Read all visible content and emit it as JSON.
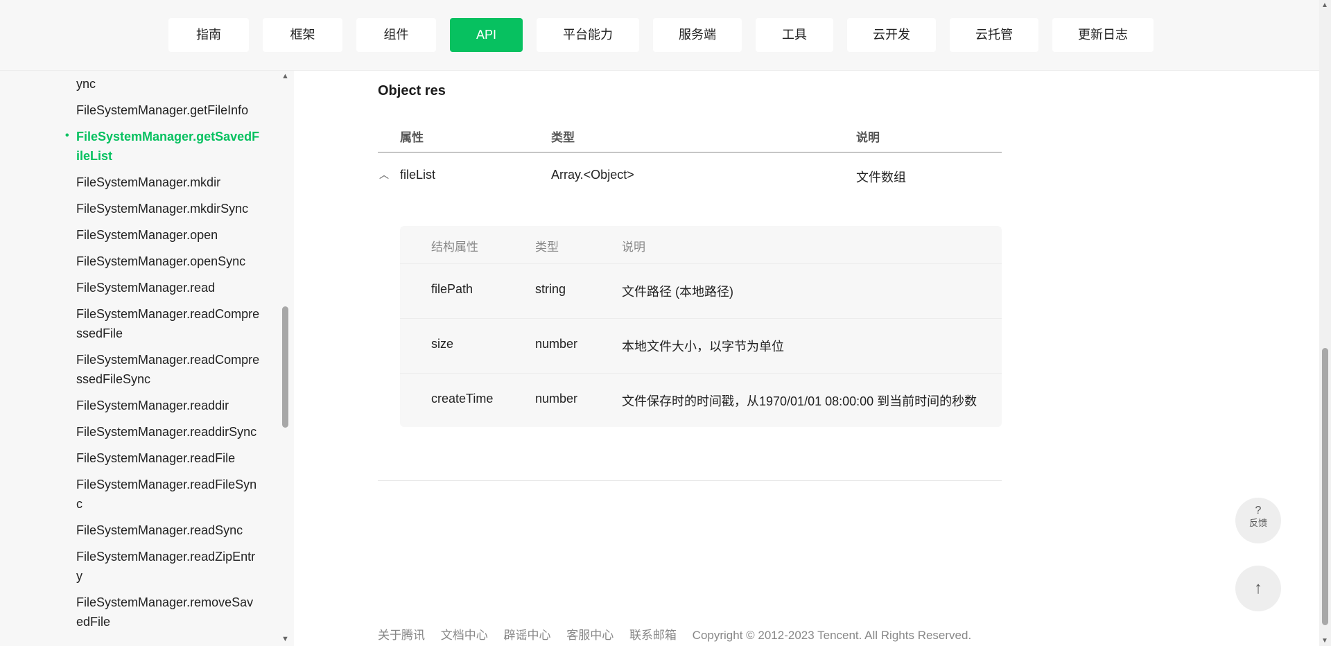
{
  "nav": {
    "tabs": [
      {
        "label": "指南"
      },
      {
        "label": "框架"
      },
      {
        "label": "组件"
      },
      {
        "label": "API",
        "active": true
      },
      {
        "label": "平台能力"
      },
      {
        "label": "服务端"
      },
      {
        "label": "工具"
      },
      {
        "label": "云开发"
      },
      {
        "label": "云托管"
      },
      {
        "label": "更新日志"
      }
    ]
  },
  "sidebar": {
    "items": [
      {
        "label": "ync"
      },
      {
        "label": "FileSystemManager.getFileInfo"
      },
      {
        "label": "FileSystemManager.getSavedFileList",
        "active": true
      },
      {
        "label": "FileSystemManager.mkdir"
      },
      {
        "label": "FileSystemManager.mkdirSync"
      },
      {
        "label": "FileSystemManager.open"
      },
      {
        "label": "FileSystemManager.openSync"
      },
      {
        "label": "FileSystemManager.read"
      },
      {
        "label": "FileSystemManager.readCompressedFile"
      },
      {
        "label": "FileSystemManager.readCompressedFileSync"
      },
      {
        "label": "FileSystemManager.readdir"
      },
      {
        "label": "FileSystemManager.readdirSync"
      },
      {
        "label": "FileSystemManager.readFile"
      },
      {
        "label": "FileSystemManager.readFileSync"
      },
      {
        "label": "FileSystemManager.readSync"
      },
      {
        "label": "FileSystemManager.readZipEntry"
      },
      {
        "label": "FileSystemManager.removeSavedFile"
      }
    ],
    "active_marker": "•"
  },
  "content": {
    "section_title": "Object res",
    "table_headers": {
      "attr": "属性",
      "type": "类型",
      "desc": "说明"
    },
    "row": {
      "name": "fileList",
      "type": "Array.<Object>",
      "desc": "文件数组",
      "expanded": true
    },
    "subtable": {
      "headers": {
        "attr": "结构属性",
        "type": "类型",
        "desc": "说明"
      },
      "rows": [
        {
          "name": "filePath",
          "type": "string",
          "desc": "文件路径 (本地路径)"
        },
        {
          "name": "size",
          "type": "number",
          "desc": "本地文件大小，以字节为单位"
        },
        {
          "name": "createTime",
          "type": "number",
          "desc": "文件保存时的时间戳，从1970/01/01 08:00:00 到当前时间的秒数"
        }
      ]
    }
  },
  "footer": {
    "links": [
      "关于腾讯",
      "文档中心",
      "辟谣中心",
      "客服中心",
      "联系邮箱"
    ],
    "copyright": "Copyright © 2012-2023 Tencent. All Rights Reserved."
  },
  "floating": {
    "feedback_symbol": "?",
    "feedback_label": "反馈",
    "back_to_top_icon": "arrow-up-icon"
  }
}
